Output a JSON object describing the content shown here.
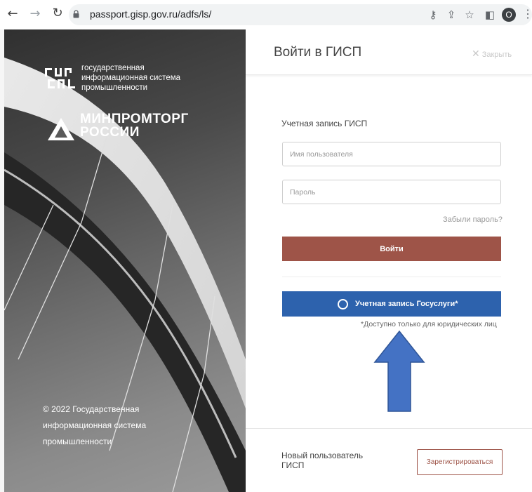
{
  "browser": {
    "url": "passport.gisp.gov.ru/adfs/ls/",
    "back_icon": "arrow-left-icon",
    "forward_icon": "arrow-right-icon",
    "reload_icon": "reload-icon",
    "avatar_letter": "O"
  },
  "hero": {
    "gisp_lines": [
      "государственная",
      "информационная система",
      "промышленности"
    ],
    "ministry_line1": "МИНПРОМТОРГ",
    "ministry_line2": "РОССИИ",
    "copyright_lines": [
      "© 2022 Государственная",
      "информационная система",
      "промышленности"
    ]
  },
  "login": {
    "title": "Войти в ГИСП",
    "close_label": "Закрыть",
    "account_label": "Учетная запись ГИСП",
    "username_placeholder": "Имя пользователя",
    "password_placeholder": "Пароль",
    "forgot_label": "Забыли пароль?",
    "submit_label": "Войти",
    "gosuslugi_label": "Учетная запись Госуслуги*",
    "gosuslugi_note": "*Доступно только для юридических лиц",
    "new_user_label": "Новый пользователь ГИСП",
    "register_label": "Зарегистрироваться"
  },
  "colors": {
    "login_button": "#9e5448",
    "gosuslugi_button": "#2d62ad",
    "arrow_fill": "#4472c4",
    "arrow_stroke": "#2f5597"
  }
}
